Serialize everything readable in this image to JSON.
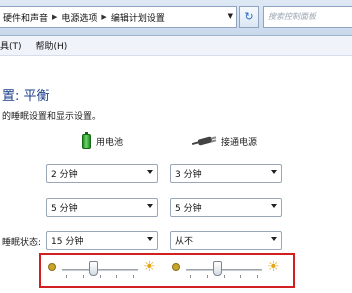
{
  "address": {
    "crumbs": [
      "硬件和声音",
      "电源选项",
      "编辑计划设置"
    ],
    "dropdown_icon": "chevron-down-icon",
    "refresh_icon": "refresh-icon",
    "search_placeholder": "搜索控制面板"
  },
  "menu": [
    "具(T)",
    "帮助(H)"
  ],
  "page": {
    "title": "置: 平衡",
    "subtitle": "的睡眠设置和显示设置。"
  },
  "columns": {
    "battery_label": "用电池",
    "plugged_label": "接通电源",
    "battery_icon": "battery-icon",
    "plugged_icon": "power-plug-icon"
  },
  "settings": {
    "row1": {
      "battery": "2 分钟",
      "plugged": "3 分钟"
    },
    "row2": {
      "battery": "5 分钟",
      "plugged": "5 分钟"
    },
    "row3": {
      "label": "睡眠状态:",
      "battery": "15 分钟",
      "plugged": "从不"
    }
  },
  "brightness": {
    "battery_level": 0.4,
    "plugged_level": 0.4,
    "dim_icon": "brightness-low-icon",
    "bright_icon": "brightness-high-icon"
  }
}
